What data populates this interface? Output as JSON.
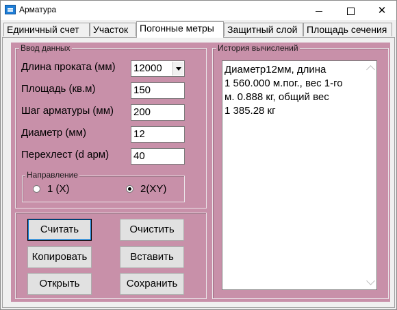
{
  "window": {
    "title": "Арматура",
    "icon": "app-icon",
    "controls": {
      "minimize": "minimize-icon",
      "maximize": "maximize-icon",
      "close": "close-icon"
    }
  },
  "tabs": [
    {
      "label": "Единичный счет",
      "active": false
    },
    {
      "label": "Участок",
      "active": false
    },
    {
      "label": "Погонные метры",
      "active": true
    },
    {
      "label": "Защитный слой",
      "active": false
    },
    {
      "label": "Площадь сечения",
      "active": false
    }
  ],
  "input_group": {
    "legend": "Ввод данных",
    "fields": [
      {
        "label": "Длина проката (мм)",
        "value": "12000"
      },
      {
        "label": "Площадь (кв.м)",
        "value": "150"
      },
      {
        "label": "Шаг арматуры (мм)",
        "value": "200"
      },
      {
        "label": "Диаметр (мм)",
        "value": "12"
      },
      {
        "label": "Перехлест (d арм)",
        "value": "40"
      }
    ],
    "direction": {
      "legend": "Направление",
      "options": [
        {
          "label": "1 (X)",
          "selected": false
        },
        {
          "label": "2(XY)",
          "selected": true
        }
      ]
    }
  },
  "buttons": {
    "calculate": "Считать",
    "clear": "Очистить",
    "copy": "Копировать",
    "paste": "Вставить",
    "open": "Открыть",
    "save": "Сохранить"
  },
  "history": {
    "legend": "История вычислений",
    "text": "Диаметр12мм, длина\n1 560.000 м.пог., вес 1-го\nм. 0.888 кг, общий вес\n1 385.28 кг"
  },
  "colors": {
    "panel": "#c890a9",
    "window": "#f0f0f0",
    "focus": "#0078d7"
  }
}
